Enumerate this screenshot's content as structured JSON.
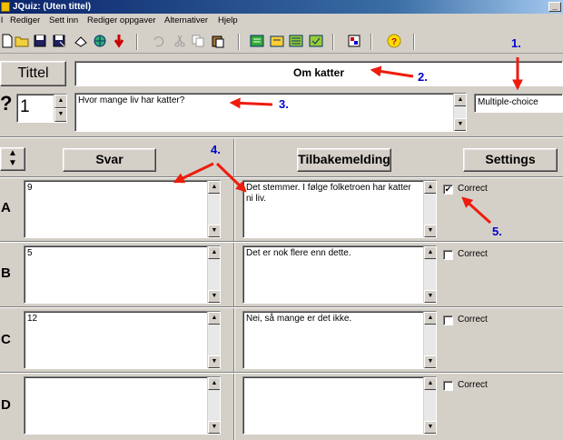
{
  "window": {
    "title": "JQuiz: (Uten tittel)"
  },
  "menu": [
    "l",
    "Rediger",
    "Sett inn",
    "Rediger oppgaver",
    "Alternativer",
    "Hjelp"
  ],
  "toolbar_icons": [
    "new-icon",
    "open-icon",
    "save-icon",
    "save-as-icon",
    "clear-icon",
    "web-export-icon",
    "export-icon",
    "undo-icon",
    "cut-icon",
    "copy-icon",
    "paste-icon",
    "add-question-icon",
    "edit-icon",
    "config-icon",
    "check-icon",
    "flag-icon",
    "help-icon"
  ],
  "title_button": "Tittel",
  "title_value": "Om katter",
  "question": {
    "label": "?",
    "number": "1",
    "text": "Hvor mange liv har katter?",
    "type": "Multiple-choice"
  },
  "headers": {
    "answers": "Svar",
    "feedback": "Tilbakemelding",
    "settings": "Settings"
  },
  "answers": [
    {
      "letter": "A",
      "answer": "9",
      "feedback": "Det stemmer.  I følge folketroen har katter ni liv.",
      "correct": true,
      "correct_label": "Correct"
    },
    {
      "letter": "B",
      "answer": "5",
      "feedback": "Det er nok flere enn dette.",
      "correct": false,
      "correct_label": "Correct"
    },
    {
      "letter": "C",
      "answer": "12",
      "feedback": "Nei, så mange er det ikke.",
      "correct": false,
      "correct_label": "Correct"
    },
    {
      "letter": "D",
      "answer": "",
      "feedback": "",
      "correct": false,
      "correct_label": "Correct"
    }
  ],
  "annotations": [
    "1.",
    "2.",
    "3.",
    "4.",
    "5."
  ],
  "colors": {
    "annotation_arrow": "#ee1c0e",
    "annotation_number": "#0000cc",
    "titlebar": "#0a246a"
  }
}
